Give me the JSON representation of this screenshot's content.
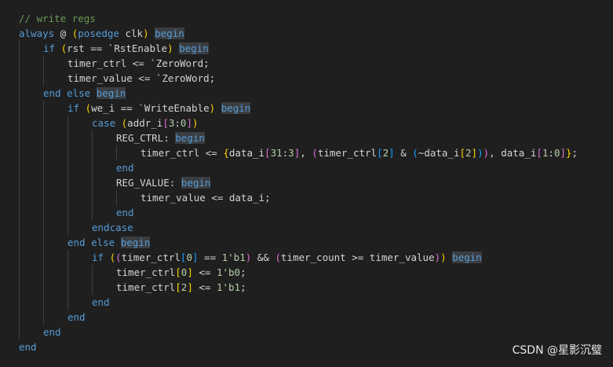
{
  "colors": {
    "background": "#1f1f1f",
    "comment": "#6a9955",
    "keyword": "#569cd6",
    "keyword_highlight_bg": "#3a3d41",
    "identifier": "#d4d4d4",
    "number": "#b5cea8",
    "bracket_gold": "#ffd700",
    "bracket_purple": "#da70d6",
    "bracket_blue": "#179fff",
    "text": "#d4d4d4"
  },
  "code": {
    "lines": [
      {
        "indent": 0,
        "tokens": [
          {
            "t": "// write regs",
            "c": "comment"
          }
        ]
      },
      {
        "indent": 0,
        "tokens": [
          {
            "t": "always",
            "c": "keyword"
          },
          {
            "t": " @ ",
            "c": "text"
          },
          {
            "t": "(",
            "c": "bracket_gold"
          },
          {
            "t": "posedge",
            "c": "keyword"
          },
          {
            "t": " clk",
            "c": "text"
          },
          {
            "t": ")",
            "c": "bracket_gold"
          },
          {
            "t": " ",
            "c": "text"
          },
          {
            "t": "begin",
            "c": "keyword",
            "hl": true
          }
        ]
      },
      {
        "indent": 1,
        "tokens": [
          {
            "t": "if",
            "c": "keyword"
          },
          {
            "t": " ",
            "c": "text"
          },
          {
            "t": "(",
            "c": "bracket_gold"
          },
          {
            "t": "rst == `RstEnable",
            "c": "text"
          },
          {
            "t": ")",
            "c": "bracket_gold"
          },
          {
            "t": " ",
            "c": "text"
          },
          {
            "t": "begin",
            "c": "keyword",
            "hl": true
          }
        ]
      },
      {
        "indent": 2,
        "tokens": [
          {
            "t": "timer_ctrl <= `ZeroWord;",
            "c": "text"
          }
        ]
      },
      {
        "indent": 2,
        "tokens": [
          {
            "t": "timer_value <= `ZeroWord;",
            "c": "text"
          }
        ]
      },
      {
        "indent": 1,
        "tokens": [
          {
            "t": "end",
            "c": "keyword"
          },
          {
            "t": " ",
            "c": "text"
          },
          {
            "t": "else",
            "c": "keyword"
          },
          {
            "t": " ",
            "c": "text"
          },
          {
            "t": "begin",
            "c": "keyword",
            "hl": true
          }
        ]
      },
      {
        "indent": 2,
        "tokens": [
          {
            "t": "if",
            "c": "keyword"
          },
          {
            "t": " ",
            "c": "text"
          },
          {
            "t": "(",
            "c": "bracket_gold"
          },
          {
            "t": "we_i == `WriteEnable",
            "c": "text"
          },
          {
            "t": ")",
            "c": "bracket_gold"
          },
          {
            "t": " ",
            "c": "text"
          },
          {
            "t": "begin",
            "c": "keyword",
            "hl": true
          }
        ]
      },
      {
        "indent": 3,
        "tokens": [
          {
            "t": "case",
            "c": "keyword"
          },
          {
            "t": " ",
            "c": "text"
          },
          {
            "t": "(",
            "c": "bracket_gold"
          },
          {
            "t": "addr_i",
            "c": "text"
          },
          {
            "t": "[",
            "c": "bracket_purple"
          },
          {
            "t": "3",
            "c": "number"
          },
          {
            "t": ":",
            "c": "text"
          },
          {
            "t": "0",
            "c": "number"
          },
          {
            "t": "]",
            "c": "bracket_purple"
          },
          {
            "t": ")",
            "c": "bracket_gold"
          }
        ]
      },
      {
        "indent": 4,
        "tokens": [
          {
            "t": "REG_CTRL: ",
            "c": "text"
          },
          {
            "t": "begin",
            "c": "keyword",
            "hl": true
          }
        ]
      },
      {
        "indent": 5,
        "tokens": [
          {
            "t": "timer_ctrl <= ",
            "c": "text"
          },
          {
            "t": "{",
            "c": "bracket_gold"
          },
          {
            "t": "data_i",
            "c": "text"
          },
          {
            "t": "[",
            "c": "bracket_purple"
          },
          {
            "t": "31",
            "c": "number"
          },
          {
            "t": ":",
            "c": "text"
          },
          {
            "t": "3",
            "c": "number"
          },
          {
            "t": "]",
            "c": "bracket_purple"
          },
          {
            "t": ", ",
            "c": "text"
          },
          {
            "t": "(",
            "c": "bracket_purple"
          },
          {
            "t": "timer_ctrl",
            "c": "text"
          },
          {
            "t": "[",
            "c": "bracket_blue"
          },
          {
            "t": "2",
            "c": "number"
          },
          {
            "t": "]",
            "c": "bracket_blue"
          },
          {
            "t": " & ",
            "c": "text"
          },
          {
            "t": "(",
            "c": "bracket_blue"
          },
          {
            "t": "~data_i",
            "c": "text"
          },
          {
            "t": "[",
            "c": "bracket_gold"
          },
          {
            "t": "2",
            "c": "number"
          },
          {
            "t": "]",
            "c": "bracket_gold"
          },
          {
            "t": ")",
            "c": "bracket_blue"
          },
          {
            "t": ")",
            "c": "bracket_purple"
          },
          {
            "t": ", data_i",
            "c": "text"
          },
          {
            "t": "[",
            "c": "bracket_purple"
          },
          {
            "t": "1",
            "c": "number"
          },
          {
            "t": ":",
            "c": "text"
          },
          {
            "t": "0",
            "c": "number"
          },
          {
            "t": "]",
            "c": "bracket_purple"
          },
          {
            "t": "}",
            "c": "bracket_gold"
          },
          {
            "t": ";",
            "c": "text"
          }
        ]
      },
      {
        "indent": 4,
        "tokens": [
          {
            "t": "end",
            "c": "keyword"
          }
        ]
      },
      {
        "indent": 4,
        "tokens": [
          {
            "t": "REG_VALUE: ",
            "c": "text"
          },
          {
            "t": "begin",
            "c": "keyword",
            "hl": true
          }
        ]
      },
      {
        "indent": 5,
        "tokens": [
          {
            "t": "timer_value <= data_i;",
            "c": "text"
          }
        ]
      },
      {
        "indent": 4,
        "tokens": [
          {
            "t": "end",
            "c": "keyword"
          }
        ]
      },
      {
        "indent": 3,
        "tokens": [
          {
            "t": "endcase",
            "c": "keyword"
          }
        ]
      },
      {
        "indent": 2,
        "tokens": [
          {
            "t": "end",
            "c": "keyword"
          },
          {
            "t": " ",
            "c": "text"
          },
          {
            "t": "else",
            "c": "keyword"
          },
          {
            "t": " ",
            "c": "text"
          },
          {
            "t": "begin",
            "c": "keyword",
            "hl": true
          }
        ]
      },
      {
        "indent": 3,
        "tokens": [
          {
            "t": "if",
            "c": "keyword"
          },
          {
            "t": " ",
            "c": "text"
          },
          {
            "t": "(",
            "c": "bracket_gold"
          },
          {
            "t": "(",
            "c": "bracket_purple"
          },
          {
            "t": "timer_ctrl",
            "c": "text"
          },
          {
            "t": "[",
            "c": "bracket_blue"
          },
          {
            "t": "0",
            "c": "number"
          },
          {
            "t": "]",
            "c": "bracket_blue"
          },
          {
            "t": " == ",
            "c": "text"
          },
          {
            "t": "1'b1",
            "c": "number"
          },
          {
            "t": ")",
            "c": "bracket_purple"
          },
          {
            "t": " && ",
            "c": "text"
          },
          {
            "t": "(",
            "c": "bracket_purple"
          },
          {
            "t": "timer_count >= timer_value",
            "c": "text"
          },
          {
            "t": ")",
            "c": "bracket_purple"
          },
          {
            "t": ")",
            "c": "bracket_gold"
          },
          {
            "t": " ",
            "c": "text"
          },
          {
            "t": "begin",
            "c": "keyword",
            "hl": true
          }
        ]
      },
      {
        "indent": 4,
        "tokens": [
          {
            "t": "timer_ctrl",
            "c": "text"
          },
          {
            "t": "[",
            "c": "bracket_gold"
          },
          {
            "t": "0",
            "c": "number"
          },
          {
            "t": "]",
            "c": "bracket_gold"
          },
          {
            "t": " <= ",
            "c": "text"
          },
          {
            "t": "1'b0",
            "c": "number"
          },
          {
            "t": ";",
            "c": "text"
          }
        ]
      },
      {
        "indent": 4,
        "tokens": [
          {
            "t": "timer_ctrl",
            "c": "text"
          },
          {
            "t": "[",
            "c": "bracket_gold"
          },
          {
            "t": "2",
            "c": "number"
          },
          {
            "t": "]",
            "c": "bracket_gold"
          },
          {
            "t": " <= ",
            "c": "text"
          },
          {
            "t": "1'b1",
            "c": "number"
          },
          {
            "t": ";",
            "c": "text"
          }
        ]
      },
      {
        "indent": 3,
        "tokens": [
          {
            "t": "end",
            "c": "keyword"
          }
        ]
      },
      {
        "indent": 2,
        "tokens": [
          {
            "t": "end",
            "c": "keyword"
          }
        ]
      },
      {
        "indent": 1,
        "tokens": [
          {
            "t": "end",
            "c": "keyword"
          }
        ]
      },
      {
        "indent": 0,
        "tokens": [
          {
            "t": "end",
            "c": "keyword"
          }
        ]
      }
    ]
  },
  "watermark": {
    "text": "CSDN @星影沉璧"
  }
}
